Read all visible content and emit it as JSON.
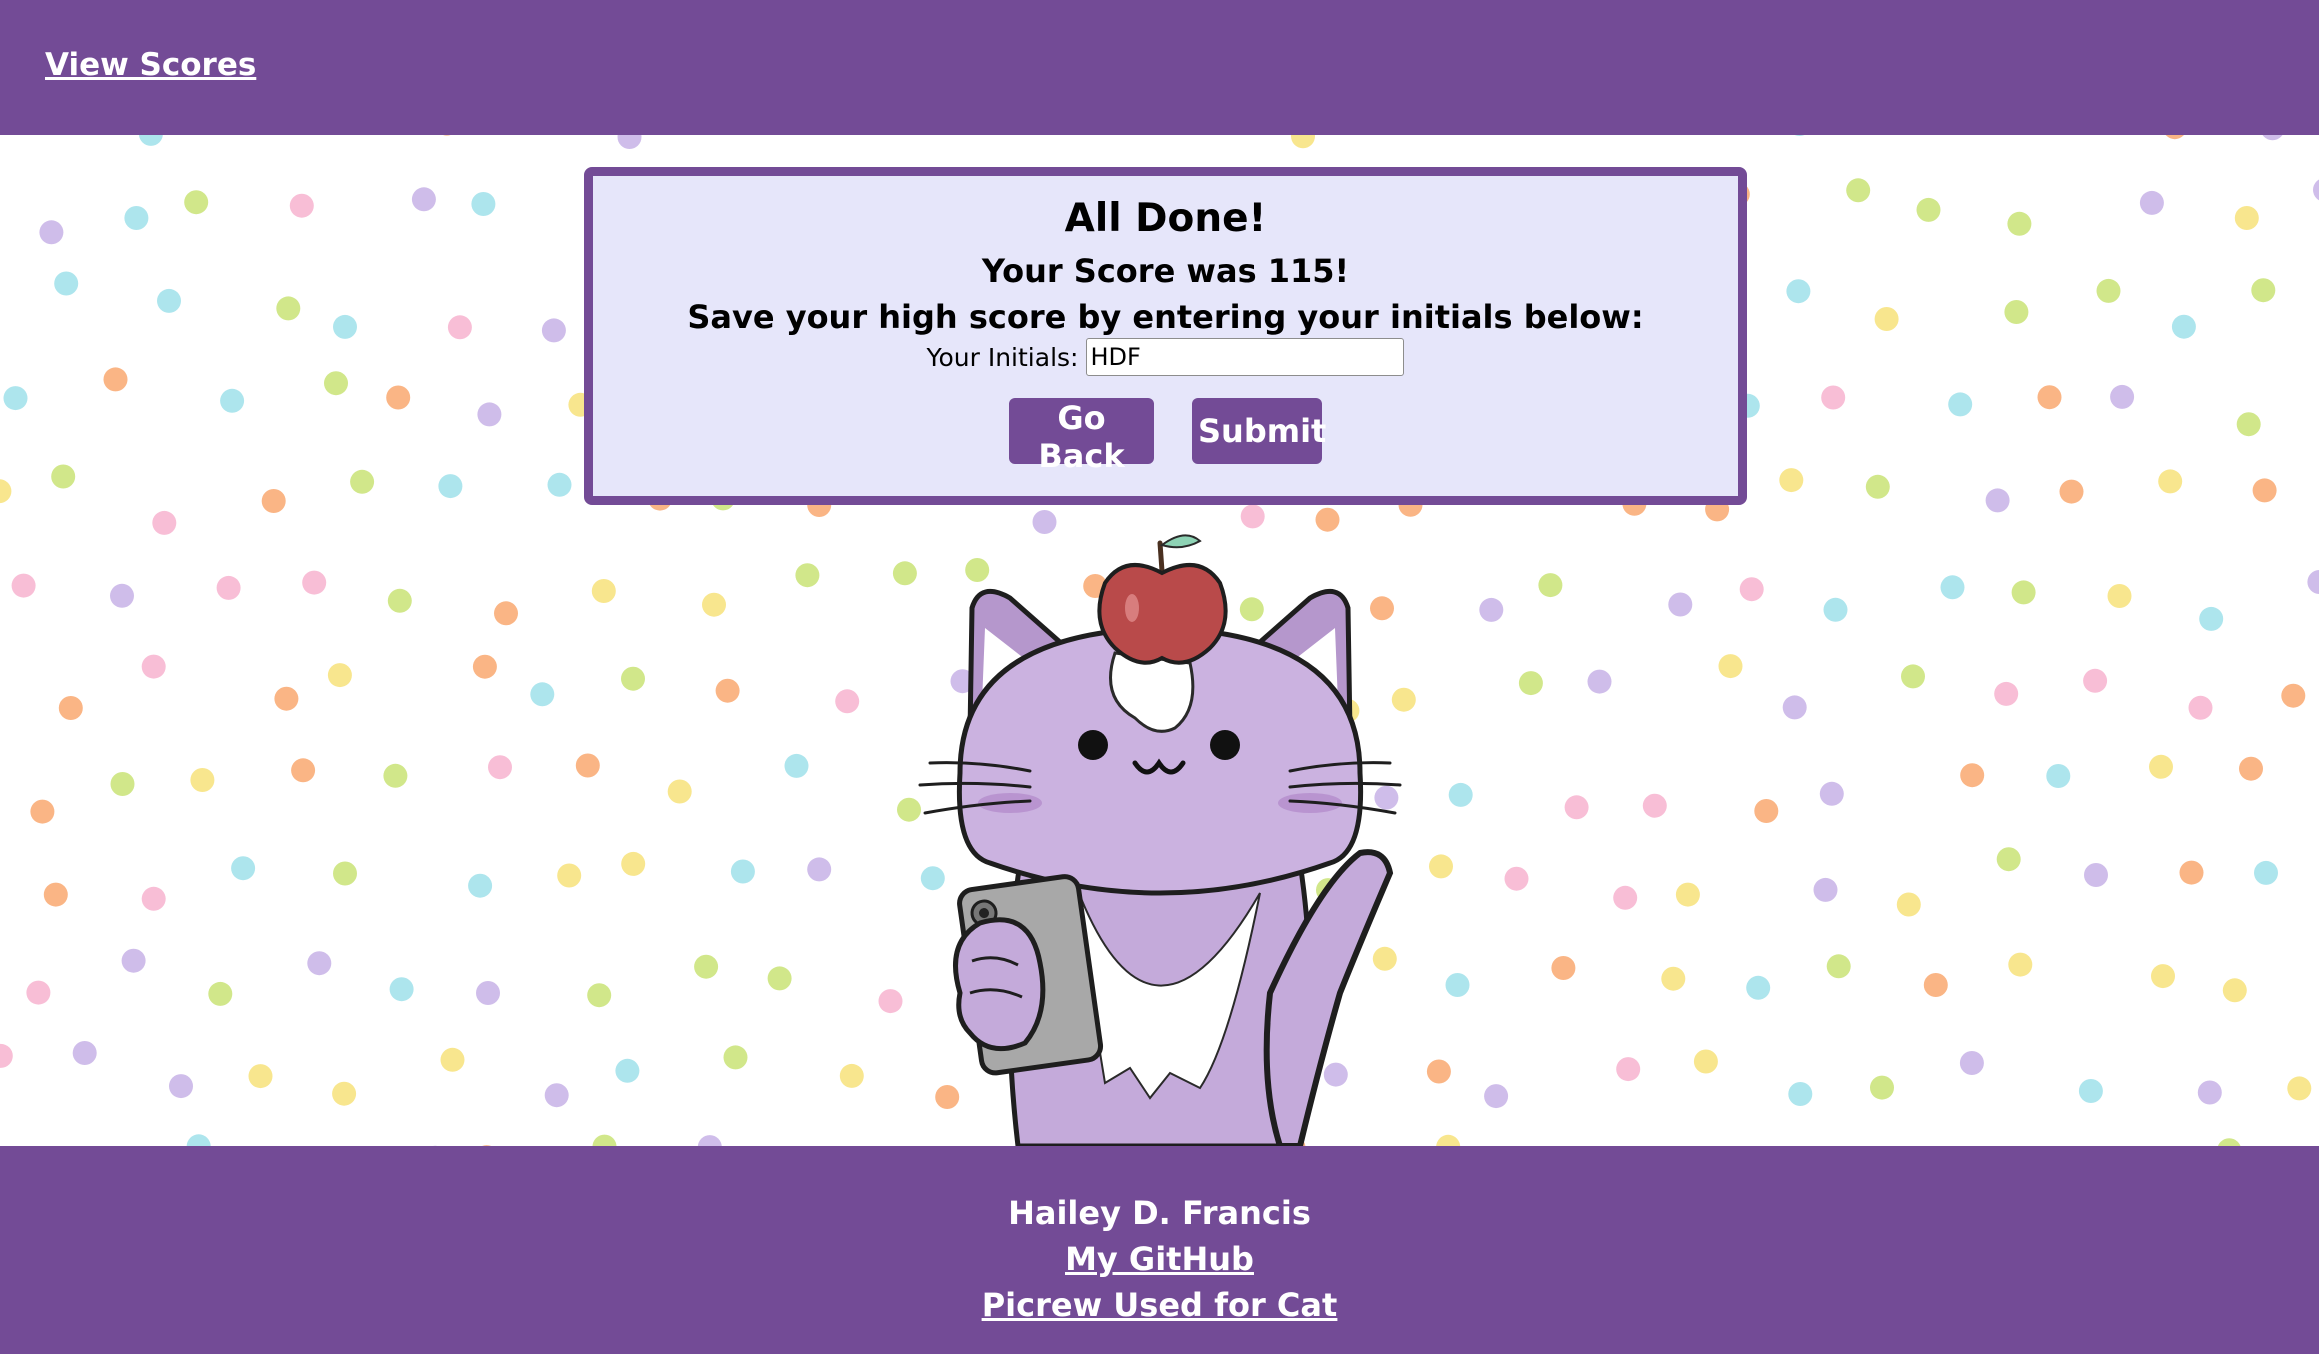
{
  "header": {
    "view_scores_link": "View Scores"
  },
  "card": {
    "title": "All Done!",
    "score_text": "Your Score was 115!",
    "prompt": "Save your high score by entering your initials below:",
    "initials_label": "Your Initials:",
    "initials_value": "HDF",
    "go_back_label": "Go Back",
    "submit_label": "Submit"
  },
  "footer": {
    "author": "Hailey D. Francis",
    "github_link": "My GitHub",
    "picrew_link": "Picrew Used for Cat"
  },
  "colors": {
    "brand_purple": "#734b96",
    "card_background": "#e6e6fa",
    "dot_colors": [
      "#f9a870",
      "#f7e27a",
      "#c9e376",
      "#9fe0ea",
      "#f7b3cf",
      "#c7b2e6"
    ]
  }
}
